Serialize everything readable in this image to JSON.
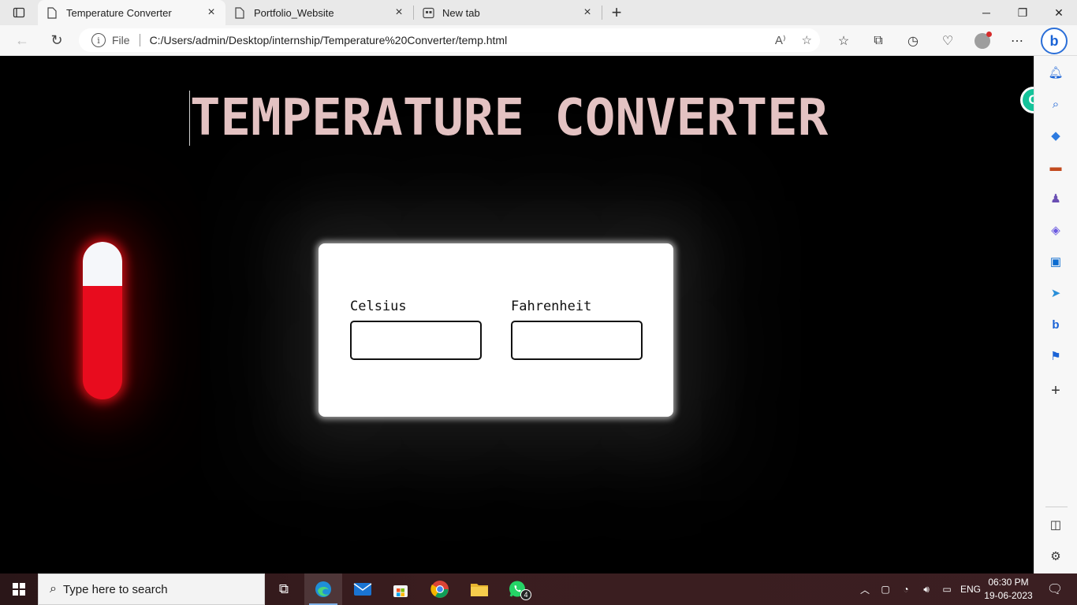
{
  "browser": {
    "tabs": [
      {
        "title": "Temperature Converter",
        "active": true
      },
      {
        "title": "Portfolio_Website",
        "active": false
      },
      {
        "title": "New tab",
        "active": false
      }
    ],
    "address": {
      "scheme_label": "File",
      "url": "C:/Users/admin/Desktop/internship/Temperature%20Converter/temp.html"
    }
  },
  "page": {
    "title": "TEMPERATURE CONVERTER",
    "thermometer": {
      "fill_level": 0.72,
      "fill_color": "#e80c1e",
      "empty_color": "#f5f7fa"
    },
    "celsius": {
      "label": "Celsius",
      "value": ""
    },
    "fahrenheit": {
      "label": "Fahrenheit",
      "value": ""
    }
  },
  "taskbar": {
    "search_placeholder": "Type here to search",
    "whatsapp_badge": "4",
    "language": "ENG",
    "time": "06:30 PM",
    "date": "19-06-2023"
  },
  "colors": {
    "title": "#e3c2c2",
    "accent": "#1a63d6",
    "grammarly": "#15c39a"
  }
}
